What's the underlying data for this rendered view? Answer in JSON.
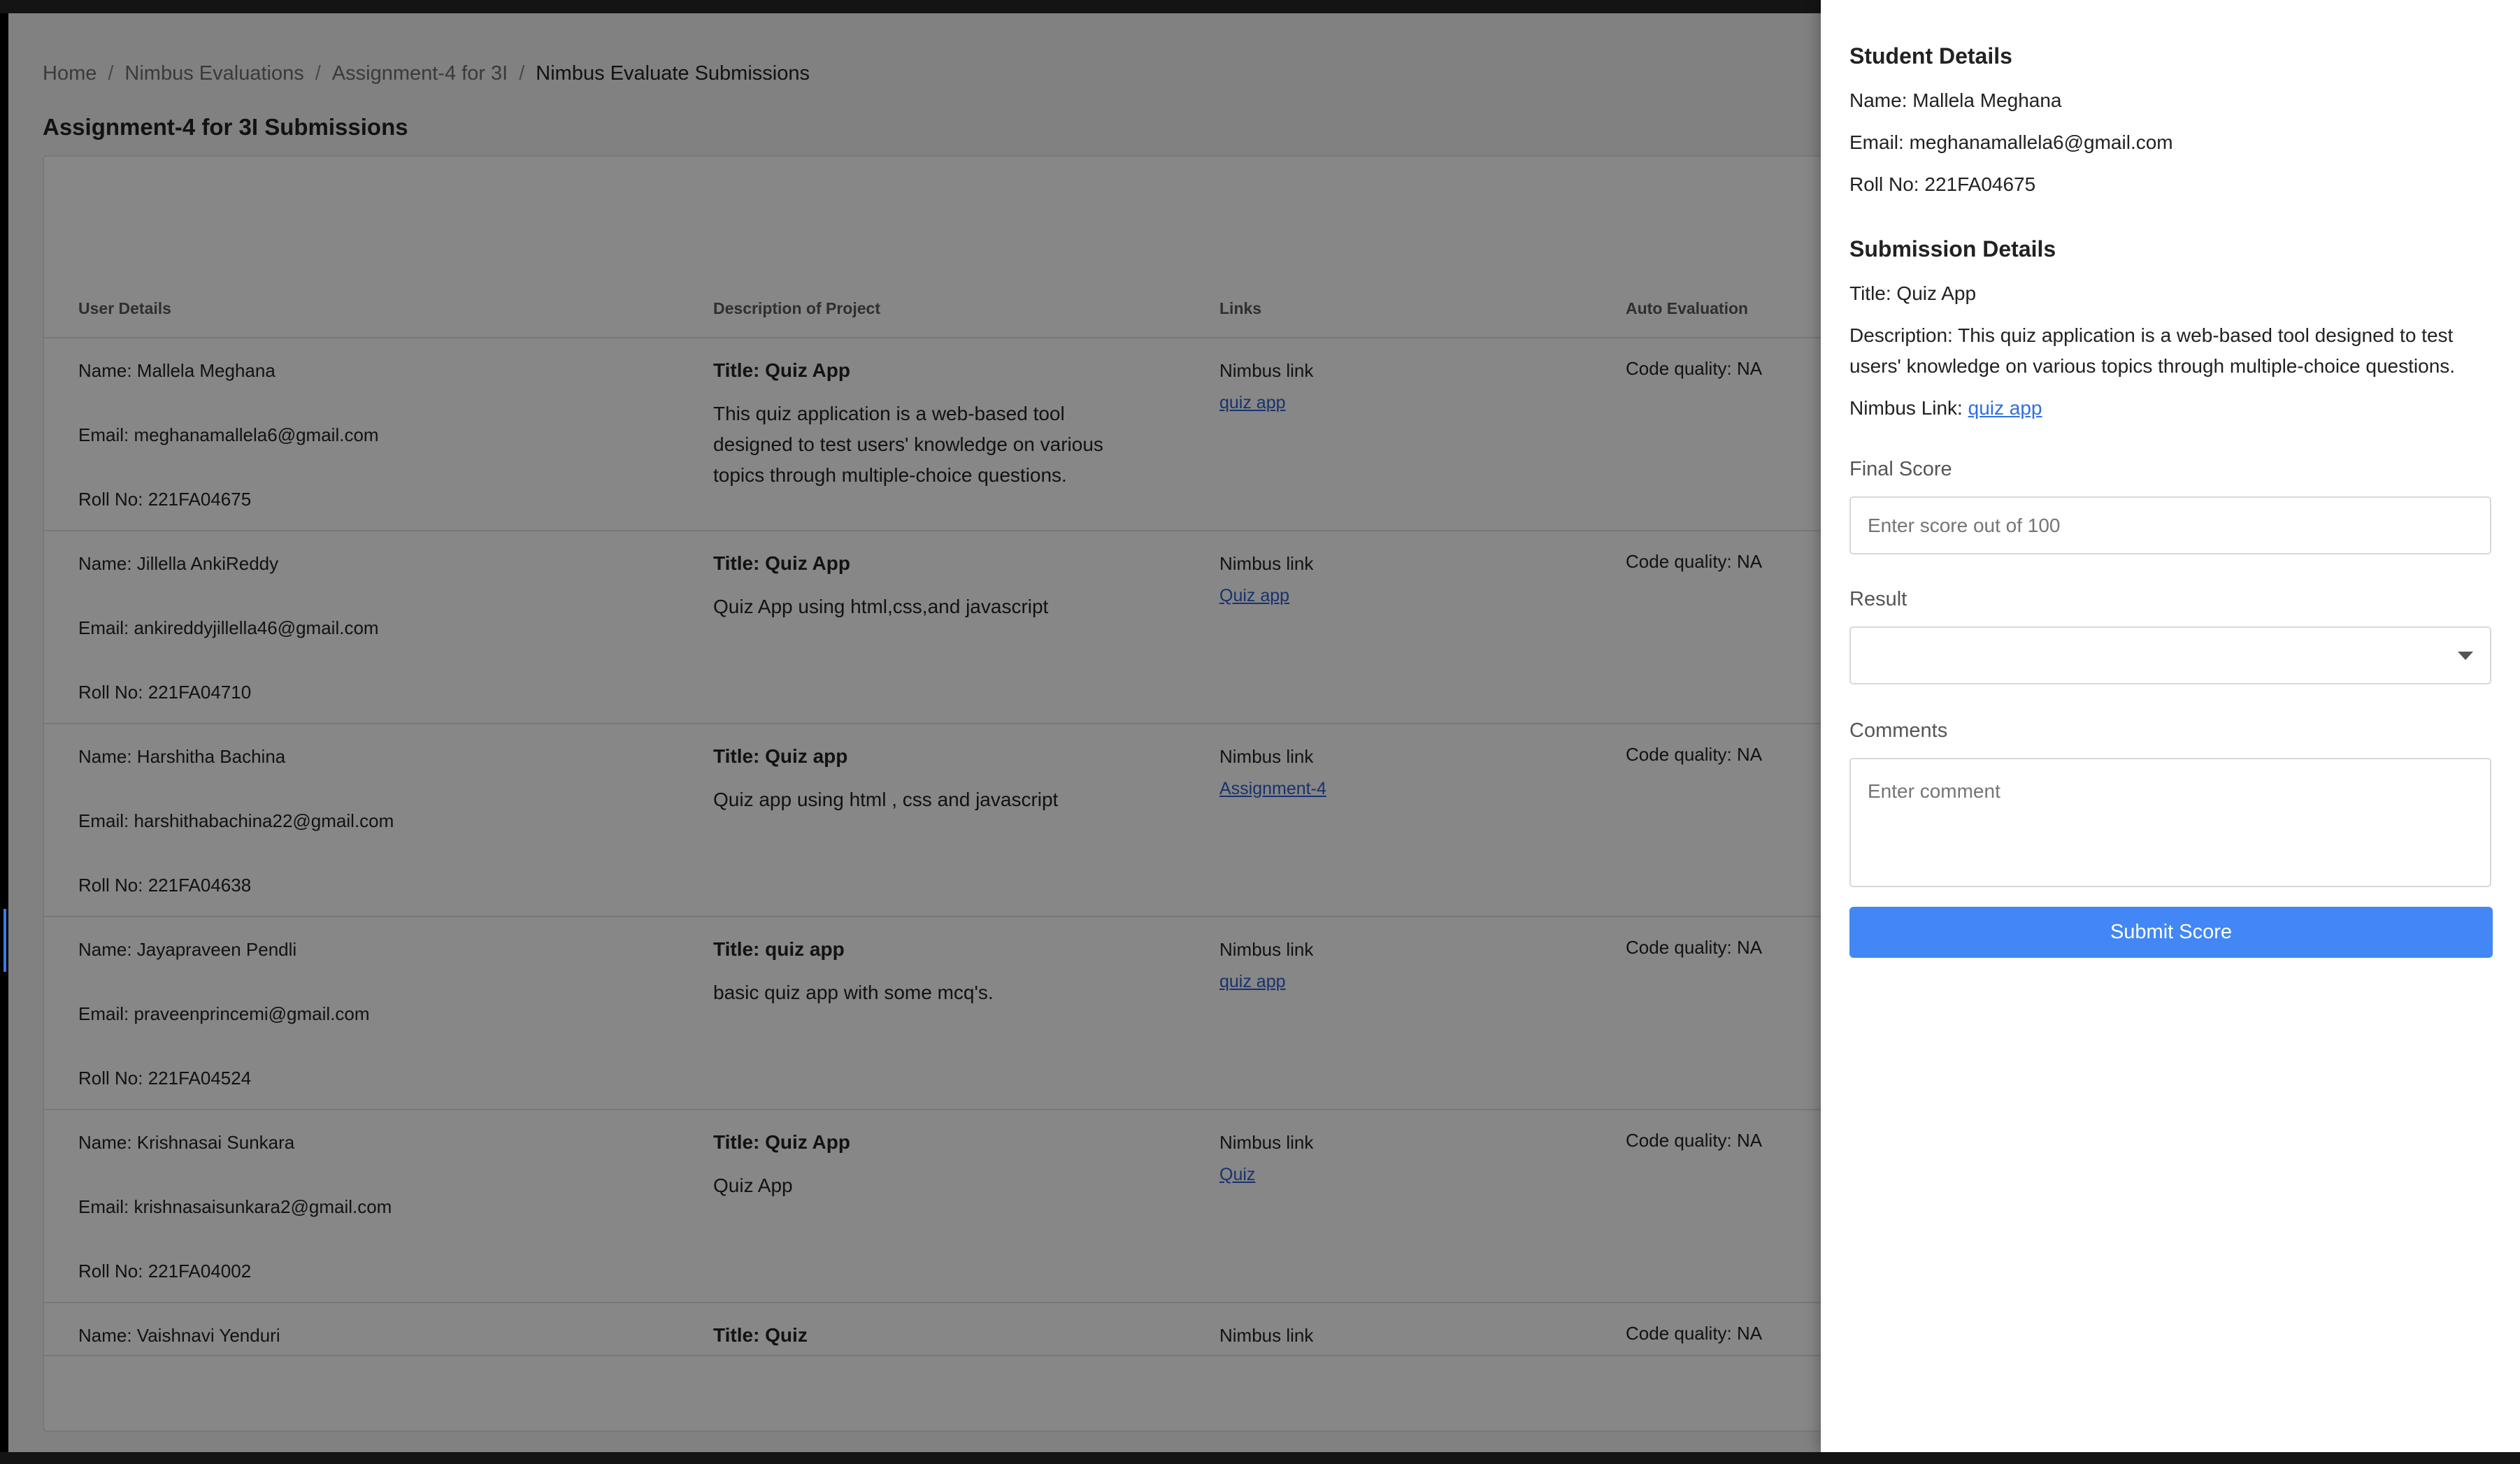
{
  "breadcrumb": [
    "Home",
    "Nimbus Evaluations",
    "Assignment-4 for 3I",
    "Nimbus Evaluate Submissions"
  ],
  "page_title": "Assignment-4 for 3I Submissions",
  "table": {
    "headers": {
      "user": "User Details",
      "desc": "Description of Project",
      "links": "Links",
      "auto": "Auto Evaluation"
    },
    "rows": [
      {
        "name": "Name: Mallela Meghana",
        "email": "Email: meghanamallela6@gmail.com",
        "roll": "Roll No: 221FA04675",
        "title": "Title: Quiz App",
        "desc": "This quiz application is a web-based tool designed to test users' knowledge on various topics through multiple-choice questions.",
        "link_label": "Nimbus link",
        "link_text": "quiz app",
        "auto": "Code quality: NA"
      },
      {
        "name": "Name: Jillella AnkiReddy",
        "email": "Email: ankireddyjillella46@gmail.com",
        "roll": "Roll No: 221FA04710",
        "title": "Title: Quiz App",
        "desc": "Quiz App using html,css,and javascript",
        "link_label": "Nimbus link",
        "link_text": "Quiz app",
        "auto": "Code quality: NA"
      },
      {
        "name": "Name: Harshitha Bachina",
        "email": "Email: harshithabachina22@gmail.com",
        "roll": "Roll No: 221FA04638",
        "title": "Title: Quiz app",
        "desc": "Quiz app using html , css and javascript",
        "link_label": "Nimbus link",
        "link_text": "Assignment-4",
        "auto": "Code quality: NA"
      },
      {
        "name": "Name: Jayapraveen Pendli",
        "email": "Email: praveenprincemi@gmail.com",
        "roll": "Roll No: 221FA04524",
        "title": "Title: quiz app",
        "desc": "basic quiz app with some mcq's.",
        "link_label": "Nimbus link",
        "link_text": "quiz app",
        "auto": "Code quality: NA"
      },
      {
        "name": "Name: Krishnasai Sunkara",
        "email": "Email: krishnasaisunkara2@gmail.com",
        "roll": "Roll No: 221FA04002",
        "title": "Title: Quiz App",
        "desc": "Quiz App",
        "link_label": "Nimbus link",
        "link_text": "Quiz",
        "auto": "Code quality: NA"
      },
      {
        "name": "Name: Vaishnavi Yenduri",
        "email": "",
        "roll": "",
        "title": "Title: Quiz",
        "desc": "",
        "link_label": "Nimbus link",
        "link_text": "",
        "auto": "Code quality: NA"
      }
    ]
  },
  "drawer": {
    "student_heading": "Student Details",
    "name": "Name: Mallela Meghana",
    "email": "Email: meghanamallela6@gmail.com",
    "roll": "Roll No: 221FA04675",
    "submission_heading": "Submission Details",
    "title": "Title: Quiz App",
    "description": "Description: This quiz application is a web-based tool designed to test users' knowledge on various topics through multiple-choice questions.",
    "nimbus_label": "Nimbus Link: ",
    "nimbus_link_text": "quiz app",
    "final_score_label": "Final Score",
    "final_score_placeholder": "Enter score out of 100",
    "result_label": "Result",
    "result_value": "",
    "comments_label": "Comments",
    "comments_placeholder": "Enter comment",
    "submit_label": "Submit Score"
  },
  "colors": {
    "accent": "#4287f5",
    "link": "#2f5fd0",
    "overlay": "rgba(0,0,0,0.47)"
  }
}
